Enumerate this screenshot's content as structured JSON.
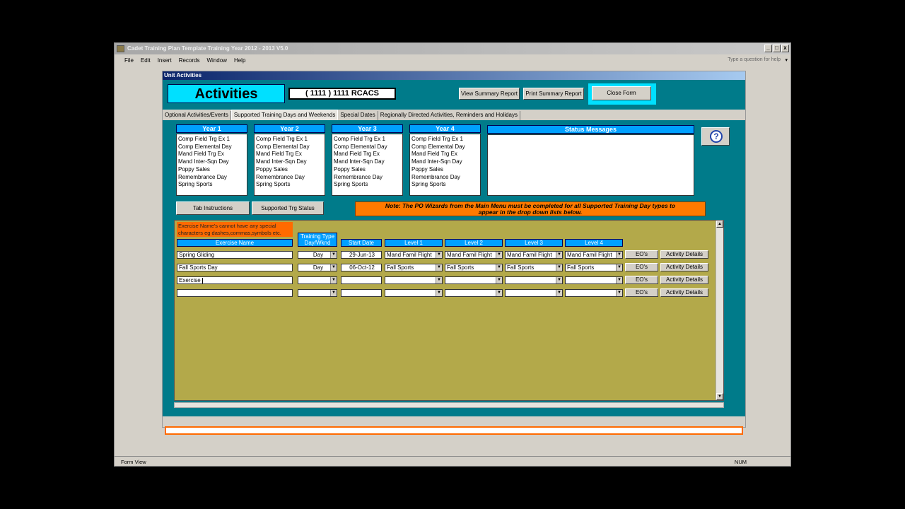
{
  "window": {
    "title": "Cadet Training Plan Template Training Year 2012 - 2013 V5.0",
    "min": "_",
    "max": "□",
    "close": "x"
  },
  "menu": [
    "File",
    "Edit",
    "Insert",
    "Records",
    "Window",
    "Help"
  ],
  "help_placeholder": "Type a question for help",
  "form": {
    "title": "Unit Activities",
    "heading": "Activities",
    "unit_name": "( 1111 ) 1111 RCACS",
    "view_summary": "View Summary Report",
    "print_summary": "Print Summary Report",
    "close_form": "Close Form",
    "tabs": [
      "Optional Activities/Events",
      "Supported Training Days and Weekends",
      "Special Dates",
      "Regionally Directed Activities, Reminders and Holidays"
    ],
    "years": [
      {
        "label": "Year 1",
        "items": [
          "Comp Field Trg Ex 1",
          "Comp Elemental Day",
          "Mand Field Trg Ex",
          "Mand Inter-Sqn Day",
          "Poppy Sales",
          "Remembrance Day",
          "Spring Sports"
        ]
      },
      {
        "label": "Year 2",
        "items": [
          "Comp Field Trg Ex 1",
          "Comp Elemental Day",
          "Mand Field Trg Ex",
          "Mand Inter-Sqn Day",
          "Poppy Sales",
          "Remembrance Day",
          "Spring Sports"
        ]
      },
      {
        "label": "Year 3",
        "items": [
          "Comp Field Trg Ex 1",
          "Comp Elemental Day",
          "Mand Field Trg Ex",
          "Mand Inter-Sqn Day",
          "Poppy Sales",
          "Remembrance Day",
          "Spring Sports"
        ]
      },
      {
        "label": "Year 4",
        "items": [
          "Comp Field Trg Ex 1",
          "Comp Elemental Day",
          "Mand Field Trg Ex",
          "Mand Inter-Sqn Day",
          "Poppy Sales",
          "Remembrance Day",
          "Spring Sports"
        ]
      }
    ],
    "status_label": "Status Messages",
    "help_glyph": "?",
    "tab_instructions": "Tab Instructions",
    "supported_status": "Supported Trg Status",
    "note_line1": "Note:  The PO Wizards from the Main Menu must be completed for all Supported Training Day types to",
    "note_line2": "appear in the drop down lists below.",
    "warning": "Exercise Name's cannot have any special characters eg dashes,commas,symbols etc.",
    "columns": {
      "name": "Exercise Name",
      "type": "Training Type Day/Wknd",
      "date": "Start Date",
      "l1": "Level 1",
      "l2": "Level 2",
      "l3": "Level 3",
      "l4": "Level 4"
    },
    "rows": [
      {
        "name": "Spring Gliding",
        "type": "Day",
        "date": "29-Jun-13",
        "l1": "Mand Famil Flight",
        "l2": "Mand Famil Flight",
        "l3": "Mand Famil Flight",
        "l4": "Mand Famil Flight"
      },
      {
        "name": "Fall Sports Day",
        "type": "Day",
        "date": "06-Oct-12",
        "l1": "Fall Sports",
        "l2": "Fall Sports",
        "l3": "Fall Sports",
        "l4": "Fall Sports"
      },
      {
        "name": "Exercise",
        "type": "",
        "date": "",
        "l1": "",
        "l2": "",
        "l3": "",
        "l4": ""
      },
      {
        "name": "",
        "type": "",
        "date": "",
        "l1": "",
        "l2": "",
        "l3": "",
        "l4": ""
      }
    ],
    "eos_label": "EO's",
    "details_label": "Activity Details"
  },
  "status": {
    "mode": "Form View",
    "num": "NUM"
  }
}
